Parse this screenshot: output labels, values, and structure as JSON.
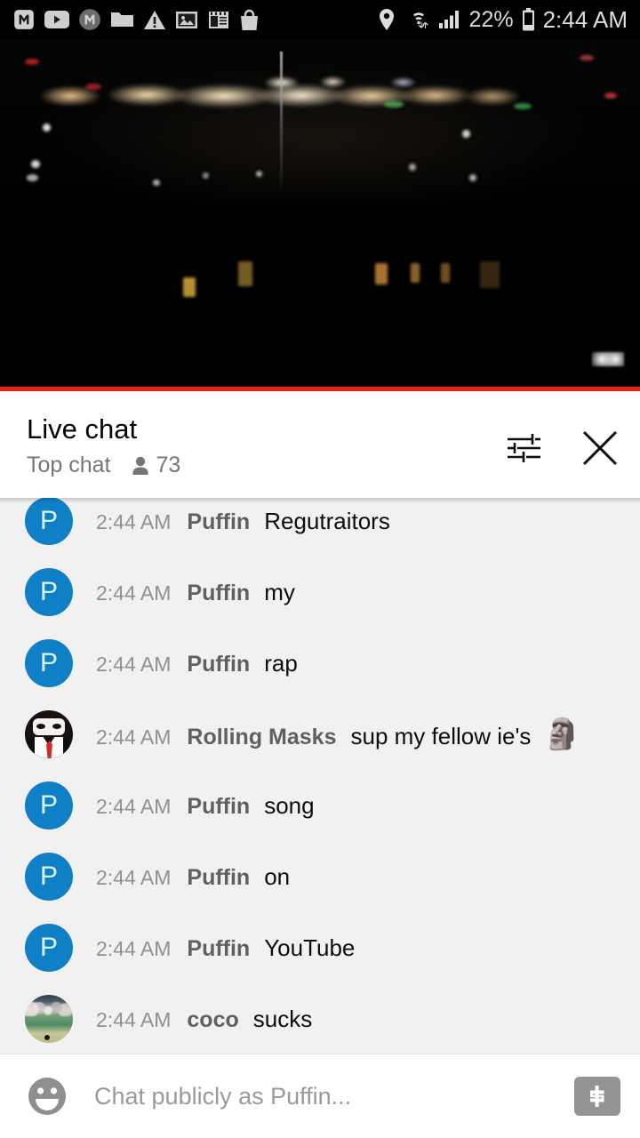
{
  "status_bar": {
    "icons_left": [
      "m-rounded-icon",
      "youtube-icon",
      "m-circle-icon",
      "folder-icon",
      "warning-triangle-icon",
      "image-icon",
      "notepad-icon",
      "shopping-bag-icon"
    ],
    "location_icon": "location-pin-icon",
    "wifi_icon": "wifi-transfer-icon",
    "signal_icon": "cellular-signal-icon",
    "battery_percent": "22%",
    "battery_icon": "battery-icon",
    "time": "2:44 AM"
  },
  "video": {
    "progress_color": "#e62117",
    "progress_percent": 100
  },
  "chat_header": {
    "title": "Live chat",
    "mode": "Top chat",
    "viewers_icon": "person-icon",
    "viewers_count": "73",
    "filter_icon": "tune-filter-icon",
    "close_icon": "close-icon"
  },
  "messages": [
    {
      "avatar_type": "puffin",
      "avatar_letter": "P",
      "time": "2:44 AM",
      "author": "Puffin",
      "text": "Regutraitors",
      "emoji": ""
    },
    {
      "avatar_type": "puffin",
      "avatar_letter": "P",
      "time": "2:44 AM",
      "author": "Puffin",
      "text": "my",
      "emoji": ""
    },
    {
      "avatar_type": "puffin",
      "avatar_letter": "P",
      "time": "2:44 AM",
      "author": "Puffin",
      "text": "rap",
      "emoji": ""
    },
    {
      "avatar_type": "masks",
      "avatar_letter": "",
      "time": "2:44 AM",
      "author": "Rolling Masks",
      "text": "sup my fellow ie's",
      "emoji": "🗿"
    },
    {
      "avatar_type": "puffin",
      "avatar_letter": "P",
      "time": "2:44 AM",
      "author": "Puffin",
      "text": "song",
      "emoji": ""
    },
    {
      "avatar_type": "puffin",
      "avatar_letter": "P",
      "time": "2:44 AM",
      "author": "Puffin",
      "text": "on",
      "emoji": ""
    },
    {
      "avatar_type": "puffin",
      "avatar_letter": "P",
      "time": "2:44 AM",
      "author": "Puffin",
      "text": "YouTube",
      "emoji": ""
    },
    {
      "avatar_type": "coco",
      "avatar_letter": "",
      "time": "2:44 AM",
      "author": "coco",
      "text": "sucks",
      "emoji": ""
    }
  ],
  "composer": {
    "emoji_icon": "emoji-smiley-icon",
    "placeholder": "Chat publicly as Puffin...",
    "value": "",
    "superchat_icon": "dollar-sign-icon"
  },
  "colors": {
    "accent_red": "#e62117",
    "avatar_blue": "#0f80c6",
    "chat_background": "#f1f1f1",
    "status_bar": "#000000"
  }
}
